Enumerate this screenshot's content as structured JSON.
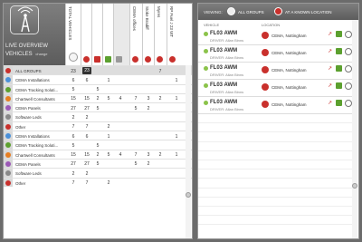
{
  "overview": {
    "title": "LIVE OVERVIEW",
    "subtitle": "VEHICLES",
    "change_link": "change"
  },
  "columns": [
    {
      "label": "TOTAL VEHICLES",
      "icon": ""
    },
    {
      "label": "",
      "icon": "pin-red-icon"
    },
    {
      "label": "",
      "icon": "route-red-icon"
    },
    {
      "label": "",
      "icon": "check-green-icon"
    },
    {
      "label": "",
      "icon": "lock-grey-icon"
    },
    {
      "label": "CEMA offices",
      "icon": "pin-red-icon"
    },
    {
      "label": "Stoke Bradiff",
      "icon": "pin-red-icon"
    },
    {
      "label": "Myres",
      "icon": "pin-red-icon"
    },
    {
      "label": "RP Fuel J 23 WT",
      "icon": "pin-red-icon"
    }
  ],
  "groups": [
    {
      "name": "ALL GROUPS",
      "values": [
        "23",
        "23",
        "",
        "",
        "",
        "",
        "",
        "7",
        ""
      ],
      "selected": true
    },
    {
      "name": "CEMA Installations",
      "values": [
        "6",
        "6",
        "",
        "1",
        "",
        "",
        "",
        "",
        "1"
      ]
    },
    {
      "name": "CEMA Tracking Soluti...",
      "values": [
        "5",
        "",
        "5",
        "",
        "",
        "",
        "",
        "",
        ""
      ]
    },
    {
      "name": "Chartwell Consultants",
      "values": [
        "15",
        "15",
        "2",
        "5",
        "4",
        "7",
        "3",
        "2",
        "1"
      ]
    },
    {
      "name": "CEMA Panels",
      "values": [
        "27",
        "27",
        "5",
        "",
        "",
        "5",
        "2",
        "",
        ""
      ]
    },
    {
      "name": "Software Leds",
      "values": [
        "2",
        "2",
        "",
        "",
        "",
        "",
        "",
        "",
        ""
      ]
    },
    {
      "name": "Other",
      "values": [
        "7",
        "7",
        "",
        "2",
        "",
        "",
        "",
        "",
        ""
      ]
    },
    {
      "name": "CEMA Installations",
      "values": [
        "6",
        "6",
        "",
        "1",
        "",
        "",
        "",
        "",
        "1"
      ]
    },
    {
      "name": "CEMA Tracking Soluti...",
      "values": [
        "5",
        "",
        "5",
        "",
        "",
        "",
        "",
        "",
        ""
      ]
    },
    {
      "name": "Chartwell Consultants",
      "values": [
        "15",
        "15",
        "2",
        "5",
        "4",
        "7",
        "3",
        "2",
        "1"
      ]
    },
    {
      "name": "CEMA Panels",
      "values": [
        "27",
        "27",
        "5",
        "",
        "",
        "5",
        "2",
        "",
        ""
      ]
    },
    {
      "name": "Software Leds",
      "values": [
        "2",
        "2",
        "",
        "",
        "",
        "",
        "",
        "",
        ""
      ]
    },
    {
      "name": "Other",
      "values": [
        "7",
        "7",
        "",
        "2",
        "",
        "",
        "",
        "",
        ""
      ]
    }
  ],
  "viewing": {
    "label": "VIEWING:",
    "all_groups": "ALL GROUPS",
    "known_location": "AT A KNOWN LOCATION"
  },
  "vehicle_table": {
    "col_vehicle": "VEHICLE",
    "col_location": "LOCATION"
  },
  "vehicles": [
    {
      "plate": "FL03 AWM",
      "driver": "DRIVER: Allan Binns",
      "location": "CEMA, Nottingham"
    },
    {
      "plate": "FL03 AWM",
      "driver": "DRIVER: Allan Binns",
      "location": "CEMA, Nottingham"
    },
    {
      "plate": "FL03 AWM",
      "driver": "DRIVER: Allan Binns",
      "location": "CEMA, Nottingham"
    },
    {
      "plate": "FL03 AWM",
      "driver": "DRIVER: Allan Binns",
      "location": "CEMA, Nottingham"
    },
    {
      "plate": "FL03 AWM",
      "driver": "DRIVER: Allan Binns",
      "location": "CEMA, Nottingham"
    }
  ],
  "colors": {
    "accent_red": "#c9302c",
    "accent_green": "#5ca02f",
    "header_grey": "#6b6b6b"
  }
}
